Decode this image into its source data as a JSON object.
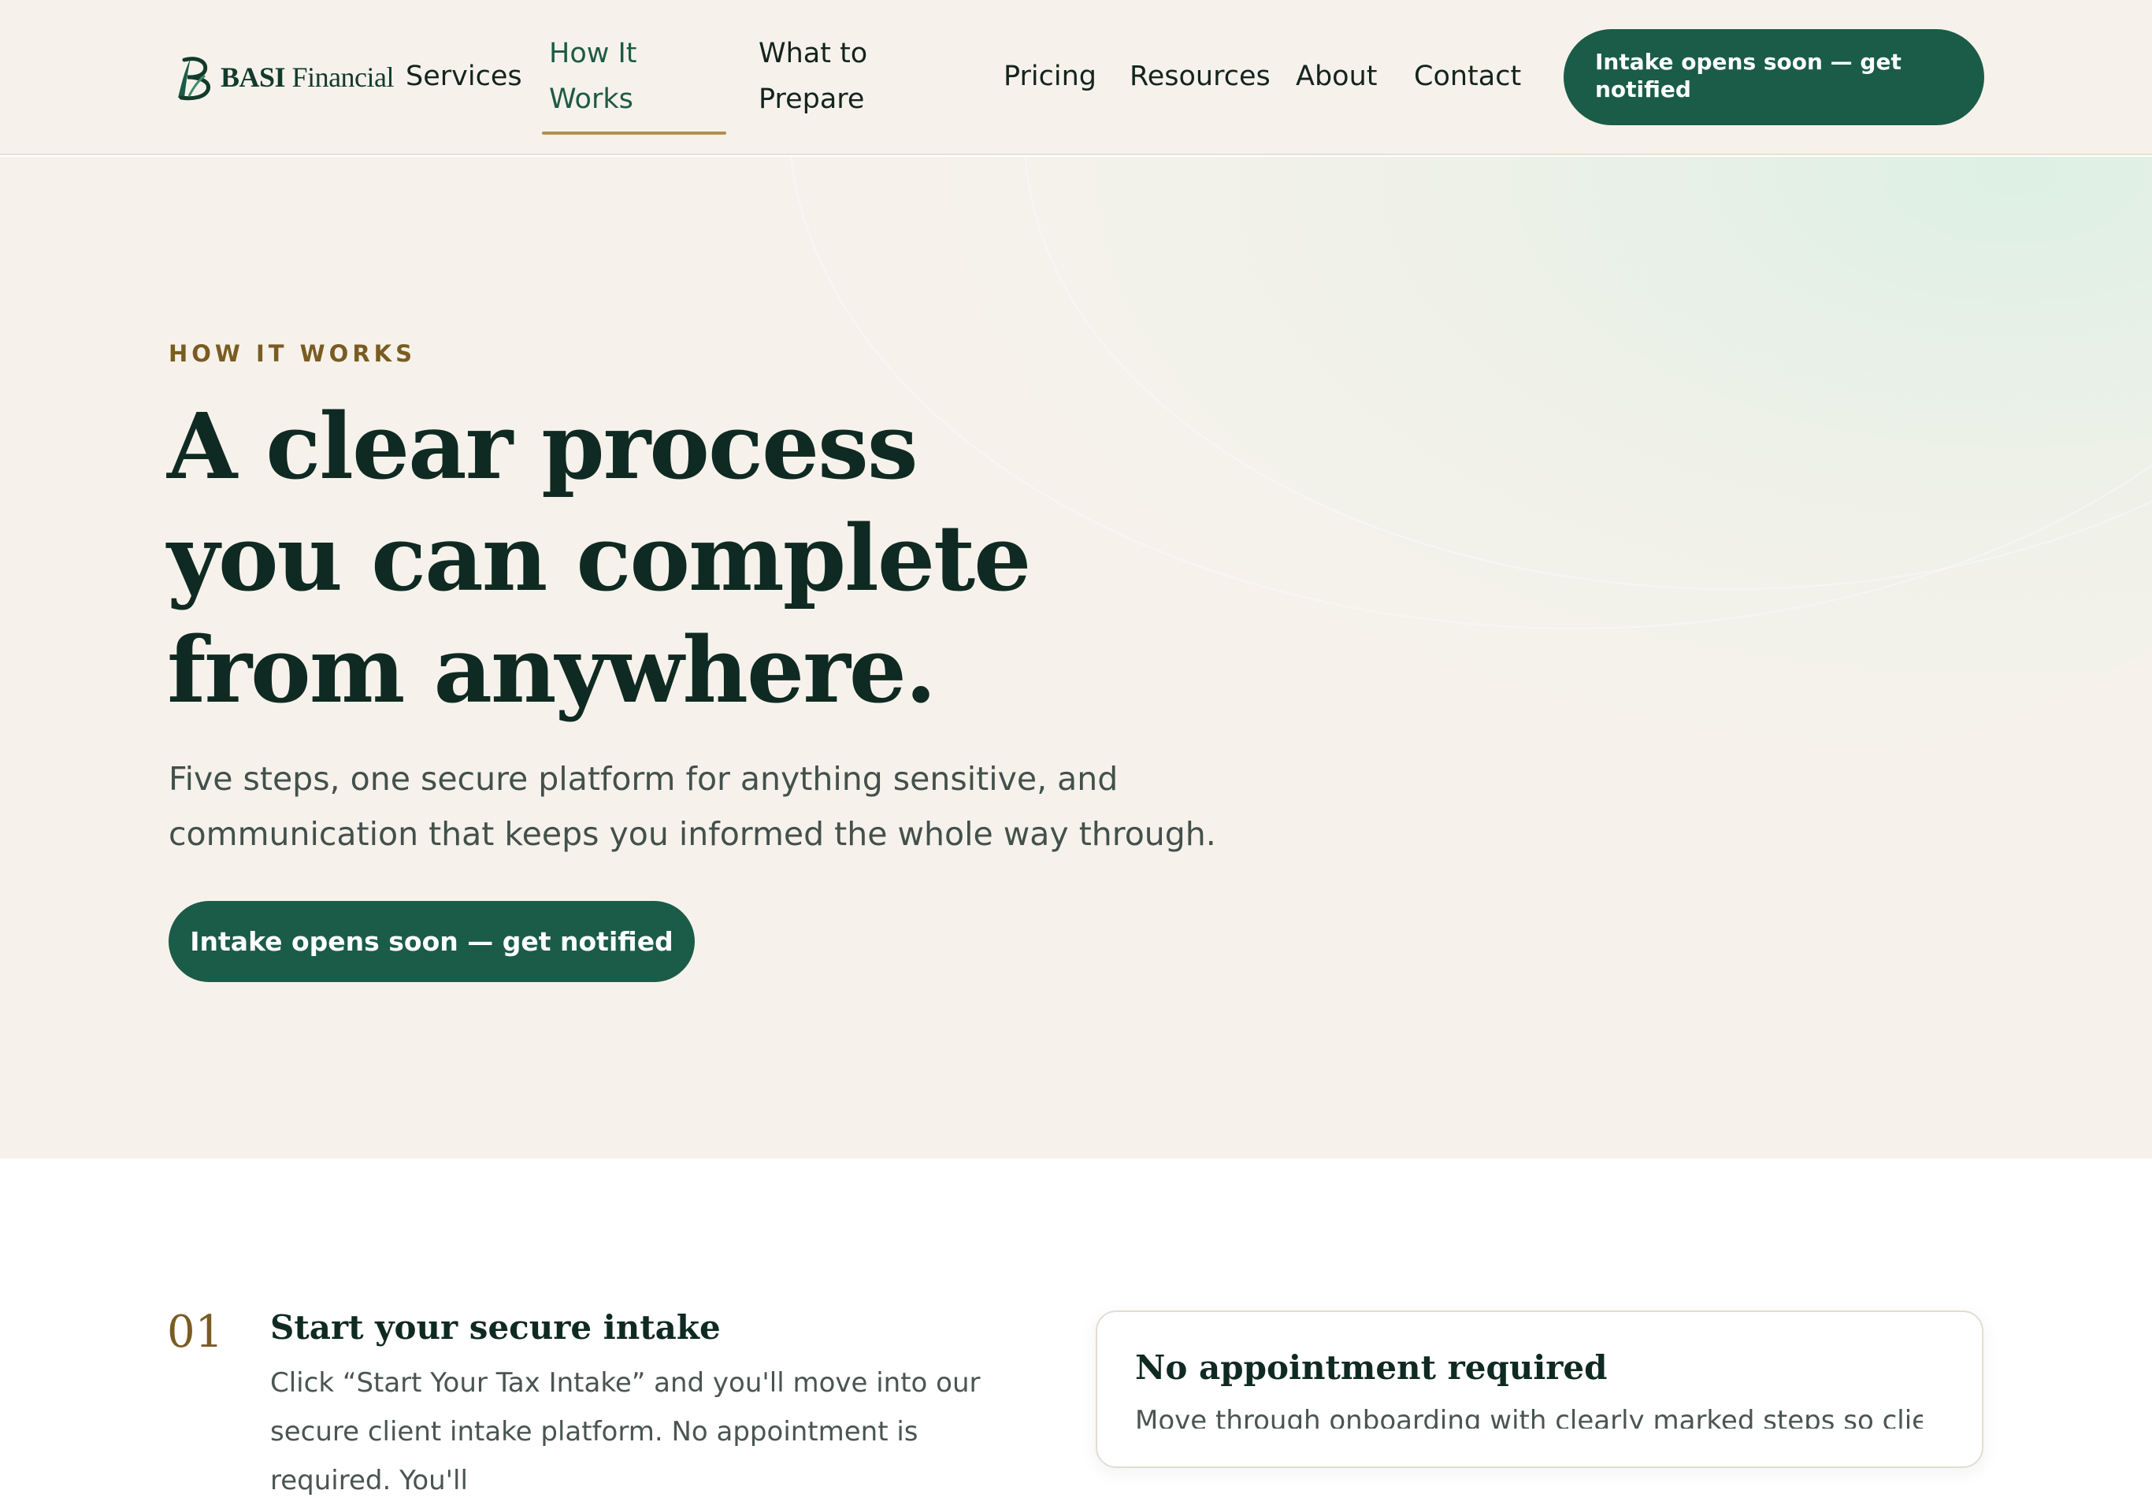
{
  "brand": {
    "logo_bold": "BASI",
    "logo_rest": " Financial"
  },
  "nav": {
    "items": [
      {
        "label": "Services"
      },
      {
        "label": "How It Works"
      },
      {
        "label": "What to Prepare"
      },
      {
        "label": "Pricing"
      },
      {
        "label": "Resources"
      },
      {
        "label": "About"
      },
      {
        "label": "Contact"
      }
    ],
    "active_index": 1,
    "cta_label": "Intake opens soon — get notified"
  },
  "hero": {
    "eyebrow": "HOW IT WORKS",
    "title": "A clear process you can complete from anywhere.",
    "subtitle": "Five steps, one secure platform for anything sensitive, and communication that keeps you informed the whole way through.",
    "cta_label": "Intake opens soon — get notified"
  },
  "steps": [
    {
      "number": "01",
      "title": "Start your secure intake",
      "description": "Click “Start Your Tax Intake” and you'll move into our secure client intake platform. No appointment is required. You'll"
    }
  ],
  "info_card": {
    "title": "No appointment required",
    "text": "Move through onboarding with clearly marked steps so clients can self-serve"
  },
  "colors": {
    "brand_green": "#1a5c47",
    "accent_gold": "#b38f4e",
    "cream_bg": "#f6f2eb",
    "heading_dark": "#0f2a22"
  }
}
